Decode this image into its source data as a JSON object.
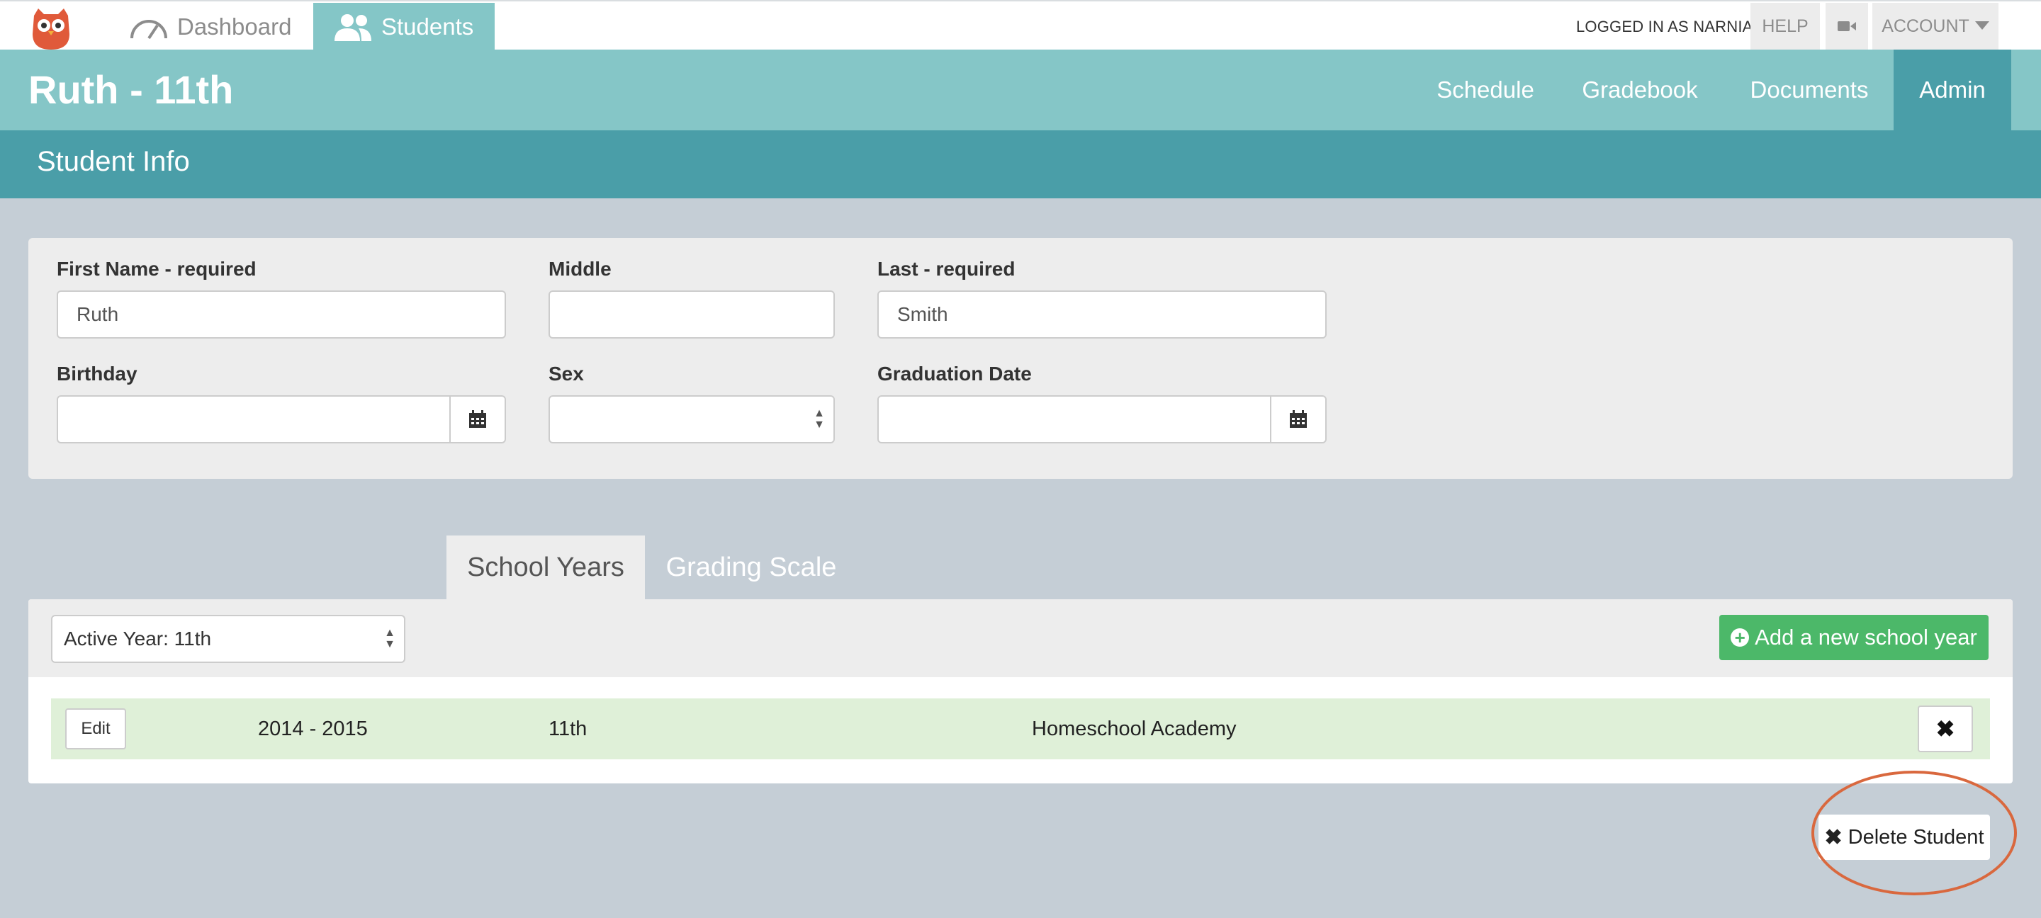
{
  "topnav": {
    "tabs": [
      {
        "label": "Dashboard",
        "icon": "speedometer-icon"
      },
      {
        "label": "Students",
        "icon": "users-icon"
      }
    ],
    "logged_in": "LOGGED IN AS NARNIA",
    "help": "HELP",
    "account": "ACCOUNT"
  },
  "student": {
    "name": "Ruth - 11th",
    "tabs": [
      "Schedule",
      "Gradebook",
      "Documents",
      "Admin"
    ],
    "active_tab": "Admin"
  },
  "section_title": "Student Info",
  "form": {
    "first_name": {
      "label": "First Name - required",
      "value": "Ruth"
    },
    "middle": {
      "label": "Middle",
      "value": ""
    },
    "last": {
      "label": "Last - required",
      "value": "Smith"
    },
    "birthday": {
      "label": "Birthday",
      "value": ""
    },
    "sex": {
      "label": "Sex",
      "value": ""
    },
    "graduation": {
      "label": "Graduation Date",
      "value": ""
    }
  },
  "tabs": {
    "school_years": "School Years",
    "grading_scale": "Grading Scale"
  },
  "years": {
    "active_select": "Active Year: 11th",
    "add_button": "Add a new school year",
    "rows": [
      {
        "edit": "Edit",
        "years": "2014 - 2015",
        "grade": "11th",
        "school": "Homeschool Academy"
      }
    ]
  },
  "delete_button": "Delete Student",
  "colors": {
    "teal_light": "#85c6c7",
    "teal_dark": "#4a9ea8",
    "green": "#4cb869",
    "highlight": "#d9683e"
  }
}
